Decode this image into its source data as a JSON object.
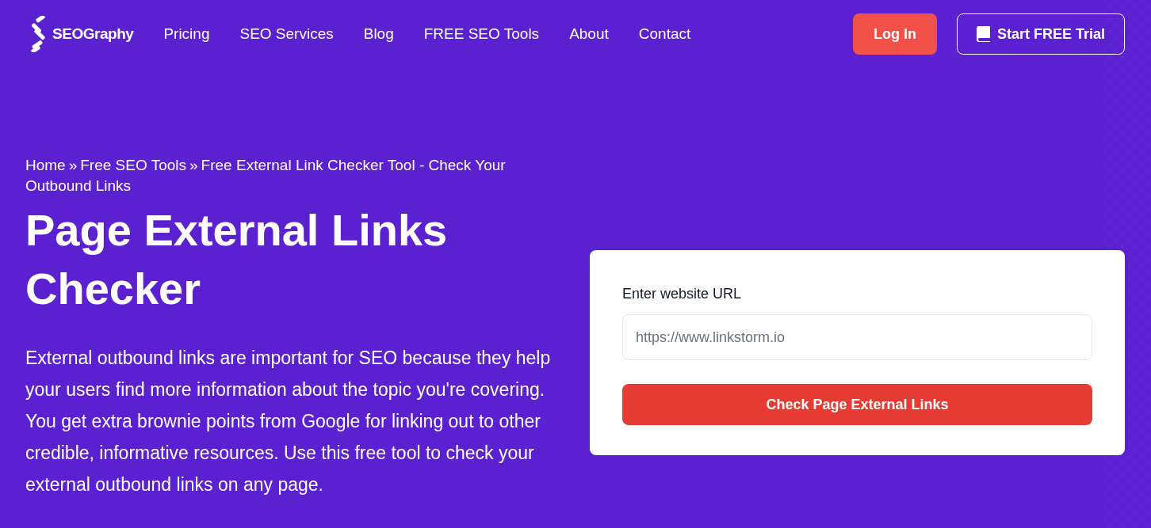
{
  "logo": {
    "text": "SEOGraphy"
  },
  "nav": [
    "Pricing",
    "SEO Services",
    "Blog",
    "FREE SEO Tools",
    "About",
    "Contact"
  ],
  "actions": {
    "login": "Log In",
    "trial": "Start FREE Trial"
  },
  "breadcrumb": [
    {
      "kind": "link",
      "text": "Home"
    },
    {
      "kind": "separator",
      "text": "»"
    },
    {
      "kind": "link",
      "text": "Free SEO Tools"
    },
    {
      "kind": "separator",
      "text": "»"
    },
    {
      "kind": "current",
      "text": "Free External Link Checker Tool - Check Your Outbound Links"
    }
  ],
  "title": "Page External Links Checker",
  "description": "External outbound links are important for SEO because they help your users find more information about the topic you're covering. You get extra brownie points from Google for linking out to other credible, informative resources. Use this free tool to check your external outbound links on any page.",
  "form": {
    "label": "Enter website URL",
    "placeholder": "https://www.linkstorm.io",
    "button": "Check Page External Links"
  }
}
